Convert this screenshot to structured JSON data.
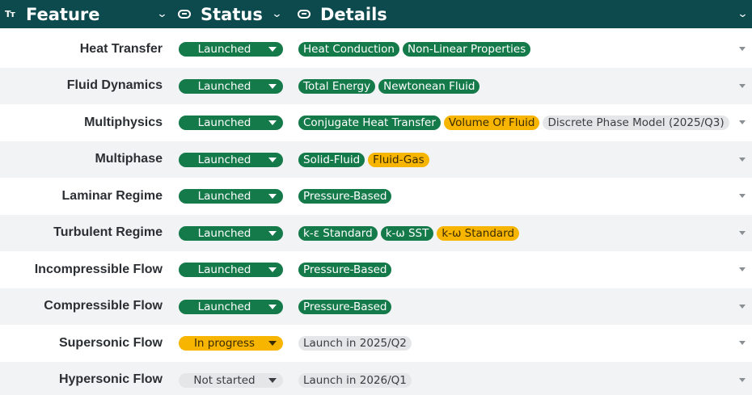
{
  "header": {
    "feature": "Feature",
    "status": "Status",
    "details": "Details",
    "feature_icon": "Tт",
    "chevron": "⌄"
  },
  "colors": {
    "header_bg": "#0c4a4d",
    "launched": "#157a4a",
    "in_progress": "#f7b500",
    "not_started": "#e4e6e8"
  },
  "rows": [
    {
      "feature": "Heat Transfer",
      "status": "Launched",
      "status_type": "launched",
      "tags": [
        {
          "text": "Heat Conduction",
          "color": "green"
        },
        {
          "text": "Non-Linear Properties",
          "color": "green"
        }
      ]
    },
    {
      "feature": "Fluid Dynamics",
      "status": "Launched",
      "status_type": "launched",
      "tags": [
        {
          "text": "Total Energy",
          "color": "green"
        },
        {
          "text": "Newtonean Fluid",
          "color": "green"
        }
      ]
    },
    {
      "feature": "Multiphysics",
      "status": "Launched",
      "status_type": "launched",
      "tags": [
        {
          "text": "Conjugate Heat Transfer",
          "color": "green"
        },
        {
          "text": "Volume Of Fluid",
          "color": "yellow"
        },
        {
          "text": "Discrete Phase Model (2025/Q3)",
          "color": "gray"
        }
      ]
    },
    {
      "feature": "Multiphase",
      "status": "Launched",
      "status_type": "launched",
      "tags": [
        {
          "text": "Solid-Fluid",
          "color": "green"
        },
        {
          "text": "Fluid-Gas",
          "color": "yellow"
        }
      ]
    },
    {
      "feature": "Laminar Regime",
      "status": "Launched",
      "status_type": "launched",
      "tags": [
        {
          "text": "Pressure-Based",
          "color": "green"
        }
      ]
    },
    {
      "feature": "Turbulent Regime",
      "status": "Launched",
      "status_type": "launched",
      "tags": [
        {
          "text": "k-ε Standard",
          "color": "green"
        },
        {
          "text": "k-ω SST",
          "color": "green"
        },
        {
          "text": "k-ω Standard",
          "color": "yellow"
        }
      ]
    },
    {
      "feature": "Incompressible Flow",
      "status": "Launched",
      "status_type": "launched",
      "tags": [
        {
          "text": "Pressure-Based",
          "color": "green"
        }
      ]
    },
    {
      "feature": "Compressible Flow",
      "status": "Launched",
      "status_type": "launched",
      "tags": [
        {
          "text": "Pressure-Based",
          "color": "green"
        }
      ]
    },
    {
      "feature": "Supersonic Flow",
      "status": "In progress",
      "status_type": "progress",
      "tags": [
        {
          "text": "Launch in 2025/Q2",
          "color": "gray"
        }
      ]
    },
    {
      "feature": "Hypersonic Flow",
      "status": "Not started",
      "status_type": "notstarted",
      "tags": [
        {
          "text": "Launch in 2026/Q1",
          "color": "gray"
        }
      ]
    }
  ]
}
